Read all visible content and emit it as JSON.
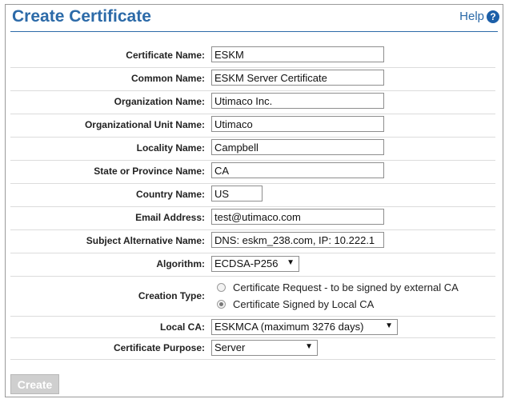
{
  "page": {
    "title": "Create Certificate",
    "help_label": "Help",
    "help_icon": "question-icon"
  },
  "fields": {
    "certificate_name": {
      "label": "Certificate Name:",
      "value": "ESKM"
    },
    "common_name": {
      "label": "Common Name:",
      "value": "ESKM Server Certificate"
    },
    "organization_name": {
      "label": "Organization Name:",
      "value": "Utimaco Inc."
    },
    "organizational_unit_name": {
      "label": "Organizational Unit Name:",
      "value": "Utimaco"
    },
    "locality_name": {
      "label": "Locality Name:",
      "value": "Campbell"
    },
    "state_name": {
      "label": "State or Province Name:",
      "value": "CA"
    },
    "country_name": {
      "label": "Country Name:",
      "value": "US"
    },
    "email_address": {
      "label": "Email Address:",
      "value": "test@utimaco.com"
    },
    "subject_alt_name": {
      "label": "Subject Alternative Name:",
      "value": "DNS: eskm_238.com, IP: 10.222.1"
    }
  },
  "algorithm": {
    "label": "Algorithm:",
    "selected": "ECDSA-P256"
  },
  "creation_type": {
    "label": "Creation Type:",
    "options": [
      "Certificate Request - to be signed by external CA",
      "Certificate Signed by Local CA"
    ],
    "selected_index": 1
  },
  "local_ca": {
    "label": "Local CA:",
    "selected": "ESKMCA (maximum 3276 days)"
  },
  "certificate_purpose": {
    "label": "Certificate Purpose:",
    "selected": "Server"
  },
  "actions": {
    "create_label": "Create"
  },
  "colors": {
    "title": "#2c6aa8",
    "help_icon": "#1c5fa8",
    "disabled_button": "#cfcfcf"
  }
}
